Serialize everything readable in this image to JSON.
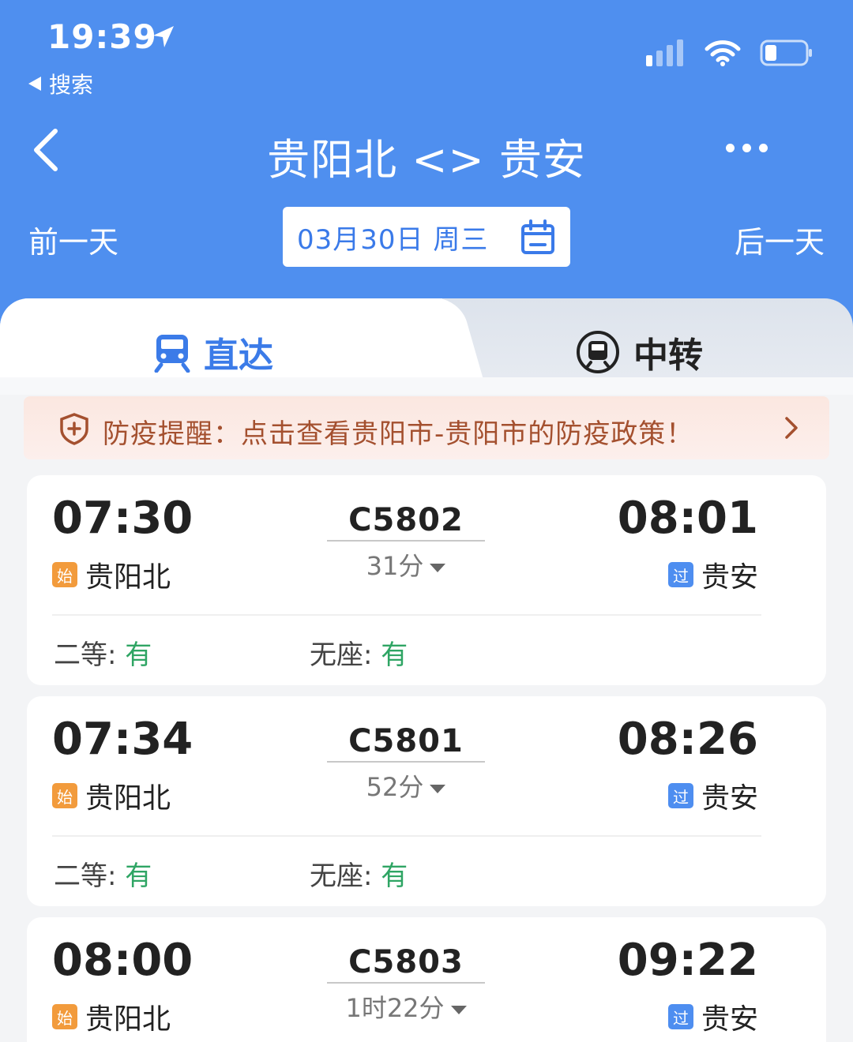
{
  "status_bar": {
    "time": "19:39",
    "back_app": "搜索"
  },
  "nav": {
    "title": "贵阳北 <> 贵安"
  },
  "date_bar": {
    "prev_day": "前一天",
    "date": "03月30日 周三",
    "next_day": "后一天"
  },
  "tabs": [
    {
      "label": "直达",
      "active": true
    },
    {
      "label": "中转",
      "active": false
    }
  ],
  "notice": {
    "text": "防疫提醒：点击查看贵阳市-贵阳市的防疫政策！"
  },
  "trains": [
    {
      "dep_time": "07:30",
      "dep_badge": "始",
      "dep_station": "贵阳北",
      "train_no": "C5802",
      "duration": "31分",
      "arr_time": "08:01",
      "arr_badge": "过",
      "arr_station": "贵安",
      "seats": [
        {
          "class": "二等",
          "status": "有"
        },
        {
          "class": "无座",
          "status": "有"
        }
      ]
    },
    {
      "dep_time": "07:34",
      "dep_badge": "始",
      "dep_station": "贵阳北",
      "train_no": "C5801",
      "duration": "52分",
      "arr_time": "08:26",
      "arr_badge": "过",
      "arr_station": "贵安",
      "seats": [
        {
          "class": "二等",
          "status": "有"
        },
        {
          "class": "无座",
          "status": "有"
        }
      ]
    },
    {
      "dep_time": "08:00",
      "dep_badge": "始",
      "dep_station": "贵阳北",
      "train_no": "C5803",
      "duration": "1时22分",
      "arr_time": "09:22",
      "arr_badge": "过",
      "arr_station": "贵安"
    }
  ],
  "colors": {
    "primary": "#4f8fef",
    "available": "#2fa564",
    "start_badge": "#f29b3c",
    "notice_text": "#a4502f"
  },
  "icons": [
    "location-arrow-icon",
    "signal-icon",
    "wifi-icon",
    "battery-icon",
    "back-chevron-icon",
    "more-icon",
    "calendar-icon",
    "train-icon",
    "transfer-icon",
    "shield-icon",
    "chevron-right-icon"
  ]
}
